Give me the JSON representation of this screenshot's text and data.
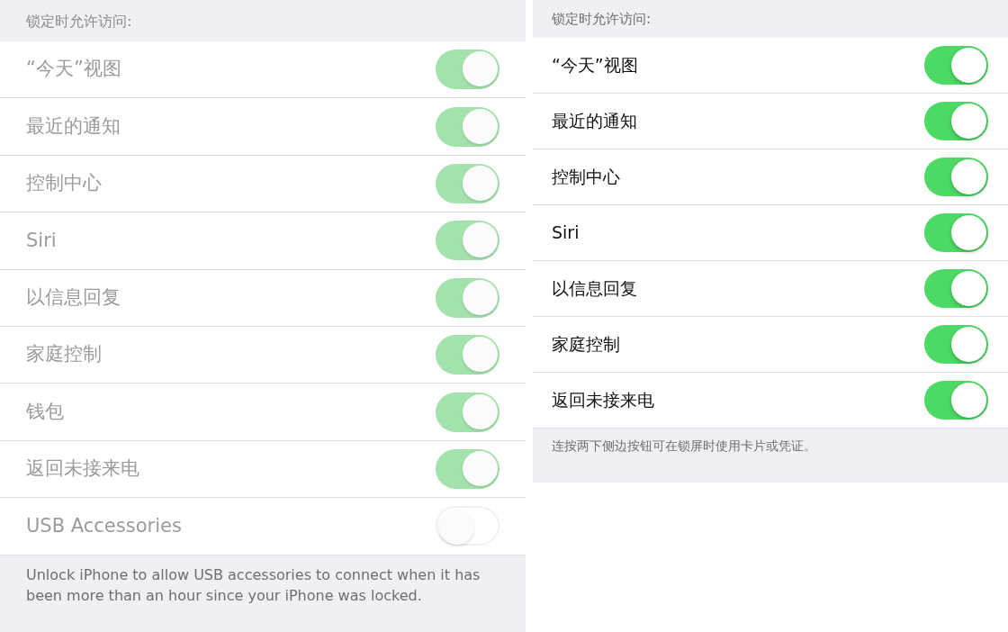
{
  "panels": [
    {
      "header": "锁定时允许访问:",
      "disabled": true,
      "rows": [
        {
          "label": "“今天”视图",
          "on": true
        },
        {
          "label": "最近的通知",
          "on": true
        },
        {
          "label": "控制中心",
          "on": true
        },
        {
          "label": "Siri",
          "on": true
        },
        {
          "label": "以信息回复",
          "on": true
        },
        {
          "label": "家庭控制",
          "on": true
        },
        {
          "label": "钱包",
          "on": true
        },
        {
          "label": "返回未接来电",
          "on": true
        },
        {
          "label": "USB Accessories",
          "on": false
        }
      ],
      "footer": "Unlock iPhone to allow USB accessories to connect when it has been more than an hour since your iPhone was locked."
    },
    {
      "header": "锁定时允许访问:",
      "disabled": false,
      "rows": [
        {
          "label": "“今天”视图",
          "on": true
        },
        {
          "label": "最近的通知",
          "on": true
        },
        {
          "label": "控制中心",
          "on": true
        },
        {
          "label": "Siri",
          "on": true
        },
        {
          "label": "以信息回复",
          "on": true
        },
        {
          "label": "家庭控制",
          "on": true
        },
        {
          "label": "返回未接来电",
          "on": true
        }
      ],
      "footer": "连按两下侧边按钮可在锁屏时使用卡片或凭证。"
    }
  ]
}
